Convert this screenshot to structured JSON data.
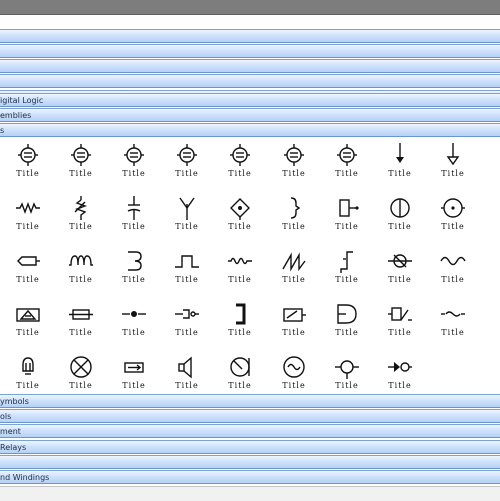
{
  "categories": [
    {
      "label": ""
    },
    {
      "label": ""
    },
    {
      "label": ""
    },
    {
      "label": ""
    },
    {
      "label": ""
    },
    {
      "label": "igital Logic"
    },
    {
      "label": "emblies"
    },
    {
      "label": "s"
    }
  ],
  "bottom_categories": [
    {
      "label": "ymbols"
    },
    {
      "label": "ols"
    },
    {
      "label": "ment"
    },
    {
      "label": "Relays"
    },
    {
      "label": ""
    },
    {
      "label": "nd Windings"
    }
  ],
  "symbols": [
    [
      {
        "icon": "electron-tube-icon",
        "caption": "Title"
      },
      {
        "icon": "electron-tube-icon",
        "caption": "Title"
      },
      {
        "icon": "electron-tube-icon",
        "caption": "Title"
      },
      {
        "icon": "electron-tube-icon",
        "caption": "Title"
      },
      {
        "icon": "electron-tube-icon",
        "caption": "Title"
      },
      {
        "icon": "electron-tube-icon",
        "caption": "Title"
      },
      {
        "icon": "electron-tube-icon",
        "caption": "Title"
      },
      {
        "icon": "ground-arrow-icon",
        "caption": "Title"
      },
      {
        "icon": "ground-triangle-icon",
        "caption": "Title"
      }
    ],
    [
      {
        "icon": "resistor-icon",
        "caption": "Title"
      },
      {
        "icon": "variable-resistor-icon",
        "caption": "Title"
      },
      {
        "icon": "capacitor-icon",
        "caption": "Title"
      },
      {
        "icon": "antenna-icon",
        "caption": "Title"
      },
      {
        "icon": "diamond-node-icon",
        "caption": "Title"
      },
      {
        "icon": "bracket-icon",
        "caption": "Title"
      },
      {
        "icon": "box-terminal-icon",
        "caption": "Title"
      },
      {
        "icon": "circle-split-icon",
        "caption": "Title"
      },
      {
        "icon": "circle-dot-icon",
        "caption": "Title"
      }
    ],
    [
      {
        "icon": "fuse-icon",
        "caption": "Title"
      },
      {
        "icon": "inductor-icon",
        "caption": "Title"
      },
      {
        "icon": "coil-icon",
        "caption": "Title"
      },
      {
        "icon": "pulse-icon",
        "caption": "Title"
      },
      {
        "icon": "wave-icon",
        "caption": "Title"
      },
      {
        "icon": "sawtooth-icon",
        "caption": "Title"
      },
      {
        "icon": "step-icon",
        "caption": "Title"
      },
      {
        "icon": "lamp-icon",
        "caption": "Title"
      },
      {
        "icon": "sine-icon",
        "caption": "Title"
      }
    ],
    [
      {
        "icon": "triangle-box-icon",
        "caption": "Title"
      },
      {
        "icon": "box-fuse-icon",
        "caption": "Title"
      },
      {
        "icon": "contact-icon",
        "caption": "Title"
      },
      {
        "icon": "connector-icon",
        "caption": "Title"
      },
      {
        "icon": "bracket-bold-icon",
        "caption": "Title"
      },
      {
        "icon": "switch-box-icon",
        "caption": "Title"
      },
      {
        "icon": "and-gate-icon",
        "caption": "Title"
      },
      {
        "icon": "relay-icon",
        "caption": "Title"
      },
      {
        "icon": "tilde-icon",
        "caption": "Title"
      }
    ],
    [
      {
        "icon": "bulb-icon",
        "caption": "Title"
      },
      {
        "icon": "cross-circle-icon",
        "caption": "Title"
      },
      {
        "icon": "box-arrow-icon",
        "caption": "Title"
      },
      {
        "icon": "speaker-icon",
        "caption": "Title"
      },
      {
        "icon": "meter-icon",
        "caption": "Title"
      },
      {
        "icon": "ac-source-icon",
        "caption": "Title"
      },
      {
        "icon": "circle-node-icon",
        "caption": "Title"
      },
      {
        "icon": "diode-node-icon",
        "caption": "Title"
      }
    ]
  ]
}
